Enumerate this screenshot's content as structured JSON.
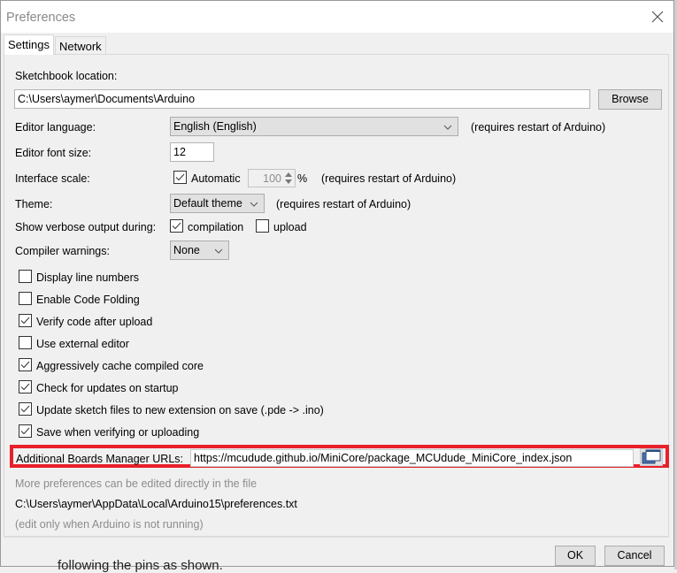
{
  "window": {
    "title": "Preferences",
    "close_icon": "close-x-icon"
  },
  "tabs": [
    {
      "label": "Settings",
      "active": true
    },
    {
      "label": "Network",
      "active": false
    }
  ],
  "settings": {
    "sketchbook": {
      "label": "Sketchbook location:",
      "value": "C:\\Users\\aymer\\Documents\\Arduino",
      "browse_label": "Browse"
    },
    "editor_language": {
      "label": "Editor language:",
      "selected": "English (English)",
      "note": "(requires restart of Arduino)"
    },
    "editor_font_size": {
      "label": "Editor font size:",
      "value": "12"
    },
    "interface_scale": {
      "label": "Interface scale:",
      "automatic_label": "Automatic",
      "automatic_checked": true,
      "value": "100",
      "unit": "%",
      "note": "(requires restart of Arduino)"
    },
    "theme": {
      "label": "Theme:",
      "selected": "Default theme",
      "note": "(requires restart of Arduino)"
    },
    "verbose": {
      "label": "Show verbose output during:",
      "compilation_label": "compilation",
      "compilation_checked": true,
      "upload_label": "upload",
      "upload_checked": false
    },
    "compiler_warnings": {
      "label": "Compiler warnings:",
      "selected": "None"
    },
    "checkboxes": [
      {
        "label": "Display line numbers",
        "checked": false
      },
      {
        "label": "Enable Code Folding",
        "checked": false
      },
      {
        "label": "Verify code after upload",
        "checked": true
      },
      {
        "label": "Use external editor",
        "checked": false
      },
      {
        "label": "Aggressively cache compiled core",
        "checked": true
      },
      {
        "label": "Check for updates on startup",
        "checked": true
      },
      {
        "label": "Update sketch files to new extension on save (.pde -> .ino)",
        "checked": true
      },
      {
        "label": "Save when verifying or uploading",
        "checked": true
      }
    ],
    "boards_manager": {
      "label": "Additional Boards Manager URLs:",
      "value": "https://mcudude.github.io/MiniCore/package_MCUdude_MiniCore_index.json",
      "highlight_color": "#e8202a"
    },
    "more_prefs_text": "More preferences can be edited directly in the file",
    "prefs_path": "C:\\Users\\aymer\\AppData\\Local\\Arduino15\\preferences.txt",
    "edit_note": "(edit only when Arduino is not running)"
  },
  "footer": {
    "ok_label": "OK",
    "cancel_label": "Cancel"
  },
  "background_text": "following the pins as shown."
}
